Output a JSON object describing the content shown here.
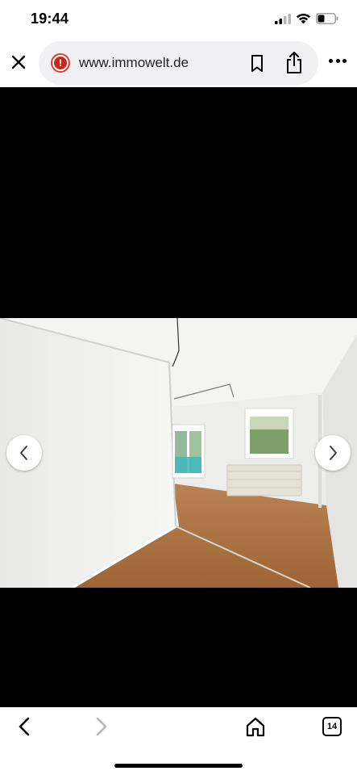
{
  "status_bar": {
    "time": "19:44"
  },
  "browser": {
    "url": "www.immowelt.de",
    "tab_count": "14"
  },
  "icons": {
    "close": "close-icon",
    "security_warning": "alert-icon",
    "bookmark": "bookmark-icon",
    "share": "share-icon",
    "more": "more-icon",
    "prev": "chevron-left-icon",
    "next": "chevron-right-icon",
    "back": "back-icon",
    "forward": "forward-icon",
    "home": "home-icon",
    "tabs": "tabs-icon"
  },
  "colors": {
    "alert": "#e03a2f",
    "content_background": "#000000"
  }
}
